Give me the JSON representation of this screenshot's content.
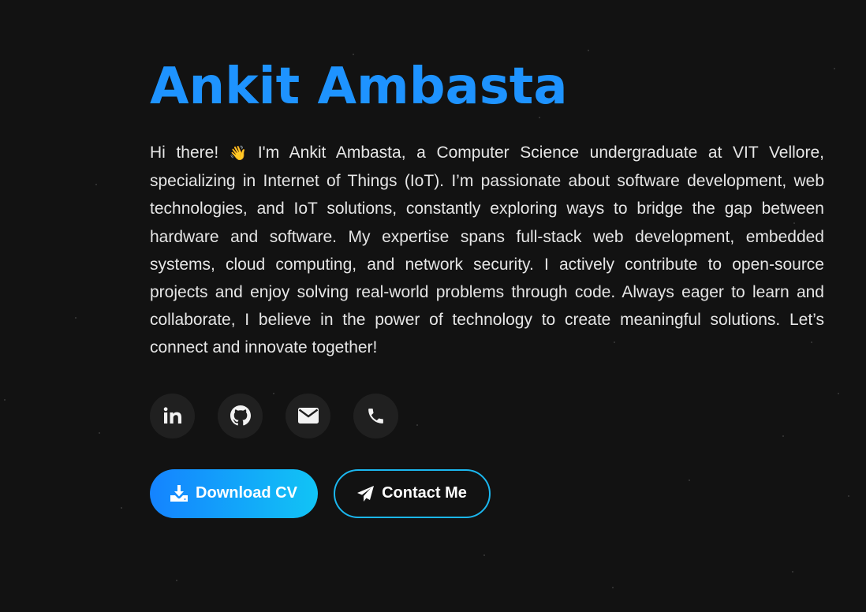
{
  "profile": {
    "name": "Ankit Ambasta",
    "bio_before": "Hi there! ",
    "wave_emoji": "👋",
    "bio_after": " I'm Ankit Ambasta, a Computer Science undergraduate at VIT Vellore, specializing in Internet of Things (IoT). I’m passionate about software development, web technologies, and IoT solutions, constantly exploring ways to bridge the gap between hardware and software. My expertise spans full-stack web development, embedded systems, cloud computing, and network security. I actively contribute to open-source projects and enjoy solving real-world problems through code. Always eager to learn and collaborate, I believe in the power of technology to create meaningful solutions. Let’s connect and innovate together!"
  },
  "socials": [
    {
      "icon": "linkedin-icon"
    },
    {
      "icon": "github-icon"
    },
    {
      "icon": "email-icon"
    },
    {
      "icon": "phone-icon"
    }
  ],
  "actions": {
    "download_label": "Download CV",
    "download_icon": "download-icon",
    "contact_label": "Contact Me",
    "contact_icon": "paper-plane-icon"
  },
  "colors": {
    "background": "#121212",
    "accent": "#1e93ff",
    "gradient_start": "#1483ff",
    "gradient_end": "#11c4f5",
    "outline": "#1bb7ef",
    "social_bg": "#202020"
  }
}
